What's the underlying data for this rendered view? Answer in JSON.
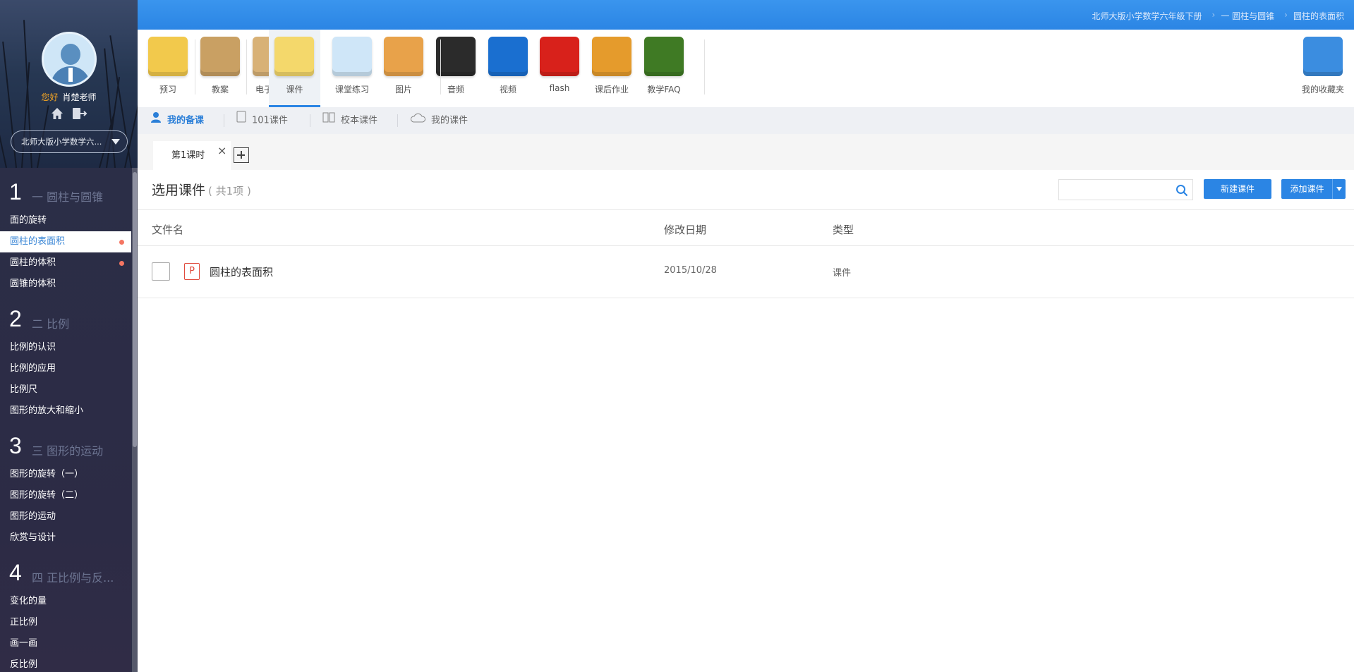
{
  "user": {
    "greeting": "您好",
    "name": "肖楚老师"
  },
  "book_select": {
    "label": "北师大版小学数学六..."
  },
  "toc": {
    "units": [
      {
        "number": "1",
        "title": "一 圆柱与圆锥",
        "lessons": [
          {
            "label": "面的旋转",
            "active": false,
            "dot": false
          },
          {
            "label": "圆柱的表面积",
            "active": true,
            "dot": true
          },
          {
            "label": "圆柱的体积",
            "active": false,
            "dot": true
          },
          {
            "label": "圆锥的体积",
            "active": false,
            "dot": false
          }
        ]
      },
      {
        "number": "2",
        "title": "二 比例",
        "lessons": [
          {
            "label": "比例的认识",
            "active": false,
            "dot": false
          },
          {
            "label": "比例的应用",
            "active": false,
            "dot": false
          },
          {
            "label": "比例尺",
            "active": false,
            "dot": false
          },
          {
            "label": "图形的放大和缩小",
            "active": false,
            "dot": false
          }
        ]
      },
      {
        "number": "3",
        "title": "三 图形的运动",
        "lessons": [
          {
            "label": "图形的旋转（一）",
            "active": false,
            "dot": false
          },
          {
            "label": "图形的旋转（二）",
            "active": false,
            "dot": false
          },
          {
            "label": "图形的运动",
            "active": false,
            "dot": false
          },
          {
            "label": "欣赏与设计",
            "active": false,
            "dot": false
          }
        ]
      },
      {
        "number": "4",
        "title": "四 正比例与反...",
        "lessons": [
          {
            "label": "变化的量",
            "active": false,
            "dot": false
          },
          {
            "label": "正比例",
            "active": false,
            "dot": false
          },
          {
            "label": "画一画",
            "active": false,
            "dot": false
          },
          {
            "label": "反比例",
            "active": false,
            "dot": false
          }
        ]
      }
    ]
  },
  "breadcrumbs": [
    "北师大版小学数学六年级下册",
    "一 圆柱与圆锥",
    "圆柱的表面积"
  ],
  "toolbar": {
    "tools": [
      {
        "label": "预习",
        "icon": "notepad-icon",
        "color": "#f2c94c"
      },
      {
        "label": "教案",
        "icon": "envelope-icon",
        "color": "#c9a063"
      },
      {
        "label": "电子教材",
        "icon": "shopping-bag-icon",
        "color": "#d8b176"
      },
      {
        "label": "课件",
        "icon": "folder-icon",
        "color": "#f4d86b"
      },
      {
        "label": "课堂练习",
        "icon": "paper-icon",
        "color": "#cfe6f8"
      },
      {
        "label": "图片",
        "icon": "picture-icon",
        "color": "#e8a24a"
      },
      {
        "label": "音频",
        "icon": "vinyl-icon",
        "color": "#2b2b2b"
      },
      {
        "label": "视频",
        "icon": "clapper-icon",
        "color": "#1a6fd0"
      },
      {
        "label": "flash",
        "icon": "flash-icon",
        "color": "#d8211b"
      },
      {
        "label": "课后作业",
        "icon": "book-pencil-icon",
        "color": "#e59b2c"
      },
      {
        "label": "教学FAQ",
        "icon": "chalkboard-icon",
        "color": "#3f7a24"
      }
    ],
    "active_index": 3,
    "favorites": {
      "label": "我的收藏夹",
      "icon": "drawer-icon",
      "color": "#3b8de0"
    }
  },
  "subtabs": [
    {
      "label": "我的备课",
      "icon": "user-icon",
      "active": true
    },
    {
      "label": "101课件",
      "icon": "document-icon",
      "active": false
    },
    {
      "label": "校本课件",
      "icon": "open-book-icon",
      "active": false
    },
    {
      "label": "我的课件",
      "icon": "cloud-icon",
      "active": false
    }
  ],
  "lesson_tab": {
    "label": "第1课时",
    "close": "×"
  },
  "content": {
    "title": "选用课件",
    "count": "( 共1项 )",
    "search": {
      "placeholder": ""
    },
    "new_button": "新建课件",
    "add_button": "添加课件"
  },
  "table": {
    "columns": [
      "文件名",
      "修改日期",
      "类型"
    ],
    "rows": [
      {
        "icon_letter": "P",
        "name": "圆柱的表面积",
        "date": "2015/10/28",
        "type": "课件"
      }
    ]
  },
  "colors": {
    "accent": "#2b85e4",
    "active_text": "#3a86d6",
    "dot": "#f57562",
    "sidebar": "#2c2f48"
  }
}
